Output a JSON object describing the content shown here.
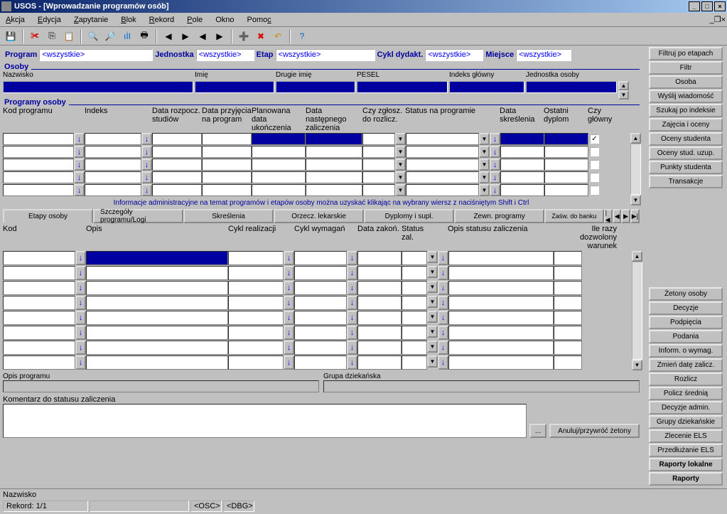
{
  "title": "USOS - [Wprowadzanie programów osób]",
  "menu": [
    "Akcja",
    "Edycja",
    "Zapytanie",
    "Blok",
    "Rekord",
    "Pole",
    "Okno",
    "Pomoc"
  ],
  "filters": {
    "program": {
      "label": "Program",
      "value": "<wszystkie>"
    },
    "jednostka": {
      "label": "Jednostka",
      "value": "<wszystkie>"
    },
    "etap": {
      "label": "Etap",
      "value": "<wszystkie>"
    },
    "cykl": {
      "label": "Cykl dydakt.",
      "value": "<wszystkie>"
    },
    "miejsce": {
      "label": "Miejsce",
      "value": "<wszystkie>"
    },
    "button": "Filtruj po etapach"
  },
  "osoby_title": "Osoby",
  "person_cols": [
    "Nazwisko",
    "Imię",
    "Drugie imię",
    "PESEL",
    "Indeks główny",
    "Jednostka osoby"
  ],
  "sidebuttons": [
    "Filtr",
    "Osoba",
    "Wyślij wiadomość",
    "Szukaj po indeksie",
    "Zajęcia i oceny",
    "Oceny studenta",
    "Oceny stud. uzup.",
    "Punkty studenta",
    "Transakcje"
  ],
  "programy_title": "Programy osoby",
  "prog_cols": [
    "Kod programu",
    "Indeks",
    "Data rozpocz. studiów",
    "Data przyjęcia na program",
    "Planowana data ukończenia",
    "Data następnego zaliczenia",
    "Czy zgłosz. do rozlicz.",
    "Status na programie",
    "Data skreślenia",
    "Ostatni dyplom",
    "Czy główny"
  ],
  "infoline": "Informacje administracyjne na temat programów i etapów osoby można uzyskać klikając na wybrany wiersz z naciśniętym Shift i Ctrl",
  "tabs": [
    "Etapy osoby",
    "Szczegóły programu/Logi",
    "Skreślenia",
    "Orzecz. lekarskie",
    "Dyplomy i supl.",
    "Zewn. programy",
    "Zaśw. do banku"
  ],
  "etapy_cols": [
    "Kod",
    "Opis",
    "Cykl realizacji",
    "Cykl wymagań",
    "Data zakoń.",
    "Status zal.",
    "Opis statusu zaliczenia",
    "Ile razy dozwolony warunek"
  ],
  "sidebuttons2": [
    "Żetony osoby",
    "Decyzje",
    "Podpięcia",
    "Podania",
    "Inform. o wymag.",
    "Zmień datę zalicz.",
    "Rozlicz",
    "Policz średnią",
    "Decyzje admin.",
    "Grupy dziekańskie",
    "Zlecenie ELS",
    "Przedłużanie ELS",
    "Raporty lokalne",
    "Raporty"
  ],
  "opis_programu": "Opis programu",
  "grupa_dziek": "Grupa dziekańska",
  "komentarz": "Komentarz do statusu zaliczenia",
  "dots_btn": "...",
  "anuluj_btn": "Anuluj/przywróć żetony",
  "status_r1": "Nazwisko",
  "status_rek": "Rekord: 1/1",
  "status_osc": "<OSC>",
  "status_dbg": "<DBG>"
}
